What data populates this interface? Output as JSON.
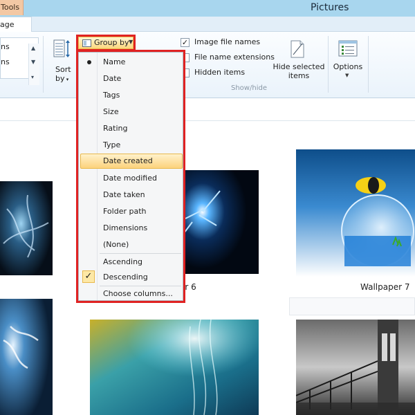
{
  "window": {
    "title": "Pictures",
    "context_tab": "Tools",
    "ribbon_tab": "age"
  },
  "ribbon": {
    "layout_items": [
      "ns",
      "ns"
    ],
    "sort_by_line1": "Sort",
    "sort_by_line2": "by",
    "group_by_label": "Group by",
    "checkboxes": [
      {
        "label": "Image file names",
        "checked": true
      },
      {
        "label": "File name extensions",
        "checked": false
      },
      {
        "label": "Hidden items",
        "checked": false
      }
    ],
    "show_hide_group_label": "Show/hide",
    "hide_selected_line1": "Hide selected",
    "hide_selected_line2": "items",
    "options_label": "Options"
  },
  "group_by_menu": {
    "items": [
      {
        "label": "Name",
        "state": "bullet"
      },
      {
        "label": "Date",
        "state": ""
      },
      {
        "label": "Tags",
        "state": ""
      },
      {
        "label": "Size",
        "state": ""
      },
      {
        "label": "Rating",
        "state": ""
      },
      {
        "label": "Type",
        "state": ""
      },
      {
        "label": "Date created",
        "state": "highlighted"
      },
      {
        "label": "Date modified",
        "state": ""
      },
      {
        "label": "Date taken",
        "state": ""
      },
      {
        "label": "Folder path",
        "state": ""
      },
      {
        "label": "Dimensions",
        "state": ""
      },
      {
        "label": "(None)",
        "state": ""
      }
    ],
    "order_items": [
      {
        "label": "Ascending",
        "state": ""
      },
      {
        "label": "Descending",
        "state": "checked"
      }
    ],
    "choose_columns": "Choose columns..."
  },
  "content": {
    "captions": [
      "er 6",
      "Wallpaper 7"
    ]
  },
  "colors": {
    "accent_highlight": "#e02222",
    "title_bar": "#a8d6ee",
    "menu_hover": "#fcd27c"
  }
}
